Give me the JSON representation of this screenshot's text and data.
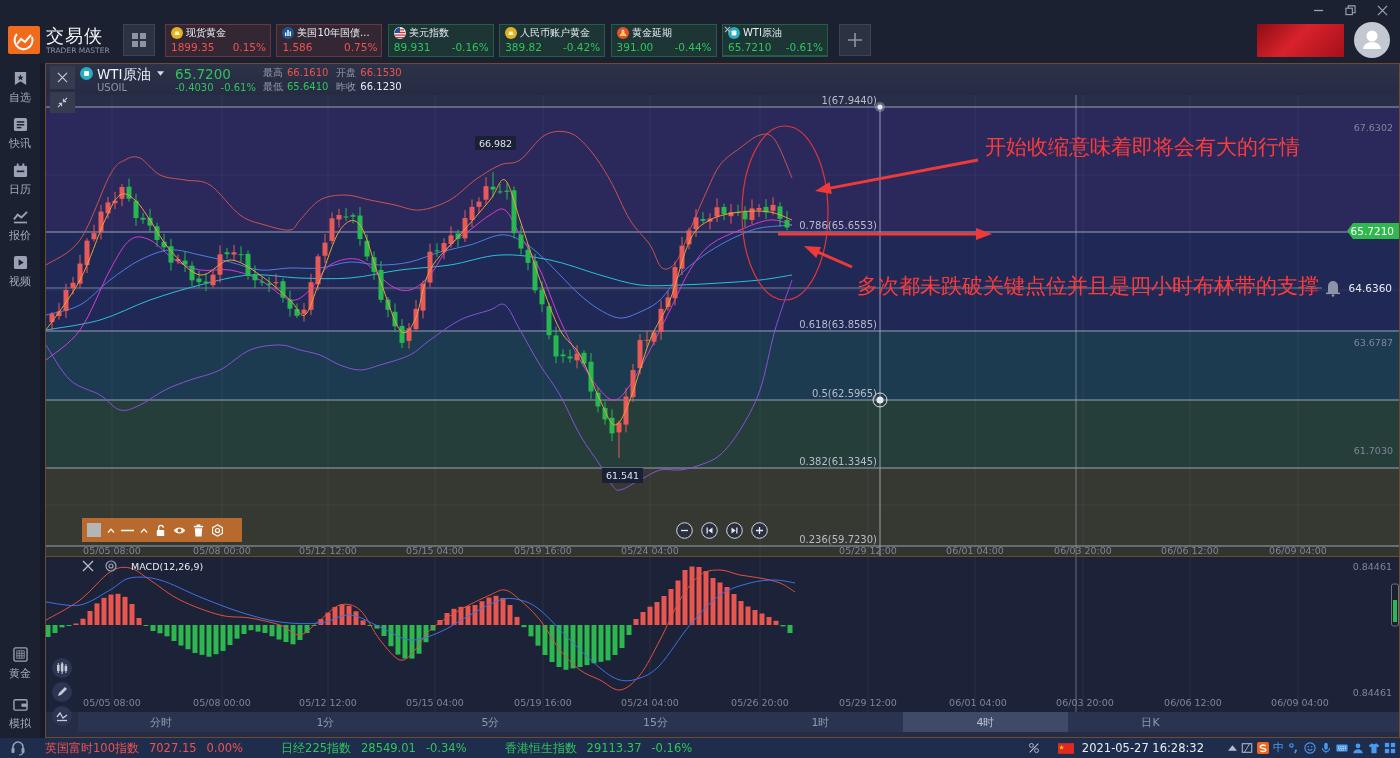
{
  "app": {
    "logo_text": "交易侠",
    "logo_subtitle": "TRADER MASTER"
  },
  "instrument_tabs": [
    {
      "kind": "coin",
      "name": "现货黄金",
      "price": "1899.35",
      "change": "0.15%",
      "color": "#f0524f",
      "selected": false
    },
    {
      "kind": "bars",
      "name": "美国10年国债...",
      "price": "1.586",
      "change": "0.75%",
      "color": "#f0524f",
      "selected": false
    },
    {
      "kind": "flag",
      "name": "美元指数",
      "price": "89.931",
      "change": "-0.16%",
      "color": "#30c45c",
      "selected": false
    },
    {
      "kind": "coin",
      "name": "人民币账户黄金",
      "price": "389.82",
      "change": "-0.42%",
      "color": "#30c45c",
      "selected": false
    },
    {
      "kind": "ingots",
      "name": "黄金延期",
      "price": "391.00",
      "change": "-0.44%",
      "color": "#30c45c",
      "selected": false
    },
    {
      "kind": "square",
      "name": "WTI原油",
      "price": "65.7210",
      "change": "-0.61%",
      "color": "#30c45c",
      "selected": true
    }
  ],
  "sidebar": {
    "top_items": [
      {
        "kind": "bookmark",
        "label": "自选"
      },
      {
        "kind": "news",
        "label": "快讯"
      },
      {
        "kind": "calendar",
        "label": "日历"
      },
      {
        "kind": "quote",
        "label": "报价"
      },
      {
        "kind": "video",
        "label": "视频"
      }
    ],
    "bottom_items": [
      {
        "kind": "gold",
        "label": "黄金"
      },
      {
        "kind": "wallet",
        "label": "模拟"
      }
    ]
  },
  "chart": {
    "symbol": "WTI原油",
    "code": "USOIL",
    "price": "65.7200",
    "change": "-0.4030",
    "change_pct": "-0.61%",
    "rising": false,
    "stats": [
      {
        "label": "最高",
        "value": "66.1610",
        "color": "#f0524f"
      },
      {
        "label": "开盘",
        "value": "66.1530",
        "color": "#f0524f"
      },
      {
        "label": "最低",
        "value": "65.6410",
        "color": "#30c45c"
      },
      {
        "label": "昨收",
        "value": "66.1230",
        "color": "#e8ebf0"
      }
    ],
    "fib_levels": [
      {
        "label": "1(67.9440)",
        "color": "#282d48"
      },
      {
        "label": "0.786(65.6553)",
        "color": "#2b295c"
      },
      {
        "label": "0.618(63.8585)",
        "color": "#202955"
      },
      {
        "label": "0.5(62.5965)",
        "color": "#1c3a50"
      },
      {
        "label": "0.382(61.3345)",
        "color": "#253e3a"
      },
      {
        "label": "0.236(59.7230)",
        "color": "#363932"
      }
    ],
    "price_axis": [
      "67.6302",
      "63.6787",
      "61.7030"
    ],
    "last_price": "65.7210",
    "alert_price": "64.6360",
    "high_label": "66.982",
    "low_label": "61.541",
    "time_axis": [
      "05/05 08:00",
      "05/08 00:00",
      "05/12 12:00",
      "05/15 04:00",
      "05/19 16:00",
      "05/24 04:00",
      "05/29 12:00",
      "06/01 04:00",
      "06/03 20:00",
      "06/06 12:00",
      "06/09 04:00"
    ],
    "annotations": [
      "开始收缩意味着即将会有大的行情",
      "多次都未跌破关键点位并且是四小时布林带的支撑"
    ]
  },
  "macd": {
    "title": "MACD(12,26,9)",
    "axis": [
      "0.84461",
      "0.84461"
    ],
    "time_axis": [
      "05/05 08:00",
      "05/08 00:00",
      "05/12 12:00",
      "05/15 04:00",
      "05/19 16:00",
      "05/24 04:00",
      "05/26 20:00",
      "05/29 12:00",
      "06/01 04:00",
      "06/03 20:00",
      "06/06 12:00",
      "06/09 04:00"
    ]
  },
  "periods": [
    {
      "label": "分时",
      "selected": false
    },
    {
      "label": "1分",
      "selected": false
    },
    {
      "label": "5分",
      "selected": false
    },
    {
      "label": "15分",
      "selected": false
    },
    {
      "label": "1时",
      "selected": false
    },
    {
      "label": "4时",
      "selected": true
    },
    {
      "label": "日K",
      "selected": false
    }
  ],
  "status_bar": {
    "tickers": [
      {
        "name": "英国富时100指数",
        "value": "7027.15",
        "change": "0.00%",
        "color": "#f0524f"
      },
      {
        "name": "日经225指数",
        "value": "28549.01",
        "change": "-0.34%",
        "color": "#30c45c"
      },
      {
        "name": "香港恒生指数",
        "value": "29113.37",
        "change": "-0.16%",
        "color": "#30c45c"
      }
    ],
    "datetime": "2021-05-27 16:28:32",
    "ime_mode": "中"
  }
}
